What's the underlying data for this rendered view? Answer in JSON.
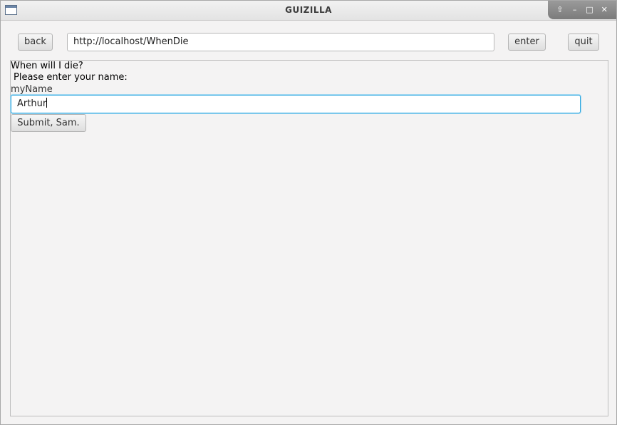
{
  "window": {
    "title": "GUIZILLA",
    "controls": {
      "shade": "⇧",
      "minimize": "–",
      "maximize": "□",
      "close": "✕"
    }
  },
  "toolbar": {
    "back_label": "back",
    "url_value": "http://localhost/WhenDie",
    "enter_label": "enter",
    "quit_label": "quit"
  },
  "page": {
    "heading": "When will I die?",
    "prompt": "Please enter your name:",
    "field_label": "myName",
    "name_value": "Arthur",
    "submit_label": "Submit, Sam."
  }
}
